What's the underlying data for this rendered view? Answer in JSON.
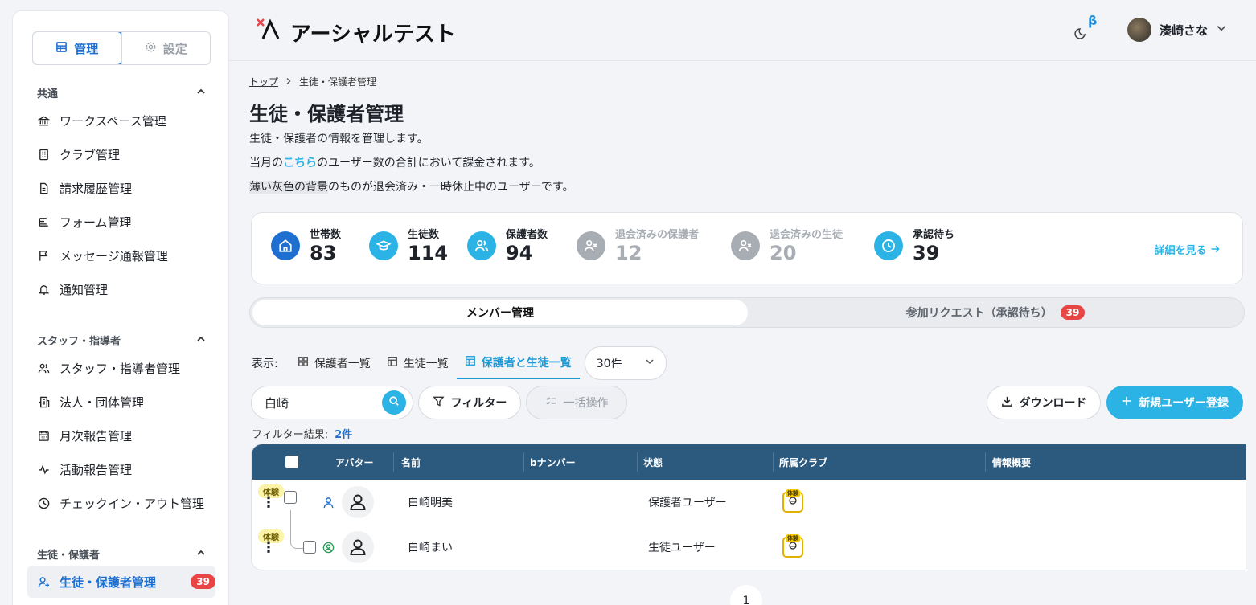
{
  "sidebar": {
    "mode_tabs": [
      {
        "label": "管理",
        "icon": "grid-icon"
      },
      {
        "label": "設定",
        "icon": "gear-icon"
      }
    ],
    "sections": [
      {
        "title": "共通",
        "items": [
          {
            "label": "ワークスペース管理",
            "icon": "bank-icon"
          },
          {
            "label": "クラブ管理",
            "icon": "building-icon"
          },
          {
            "label": "請求履歴管理",
            "icon": "invoice-icon"
          },
          {
            "label": "フォーム管理",
            "icon": "form-icon"
          },
          {
            "label": "メッセージ通報管理",
            "icon": "flag-icon"
          },
          {
            "label": "通知管理",
            "icon": "bell-icon"
          }
        ]
      },
      {
        "title": "スタッフ・指導者",
        "items": [
          {
            "label": "スタッフ・指導者管理",
            "icon": "users-icon"
          },
          {
            "label": "法人・団体管理",
            "icon": "office-icon"
          },
          {
            "label": "月次報告管理",
            "icon": "calendar-icon"
          },
          {
            "label": "活動報告管理",
            "icon": "activity-icon"
          },
          {
            "label": "チェックイン・アウト管理",
            "icon": "clock-icon"
          }
        ]
      },
      {
        "title": "生徒・保護者",
        "items": [
          {
            "label": "生徒・保護者管理",
            "icon": "user-plus-icon",
            "badge": "39",
            "active": true
          }
        ]
      }
    ]
  },
  "header": {
    "brand": "アーシャルテスト",
    "beta_mark": "β",
    "user_name": "湊崎さな"
  },
  "breadcrumb": {
    "home": "トップ",
    "current": "生徒・保護者管理"
  },
  "page": {
    "title": "生徒・保護者管理",
    "desc1": "生徒・保護者の情報を管理します。",
    "desc2_pre": "当月の",
    "desc2_link": "こちら",
    "desc2_post": "のユーザー数の合計において課金されます。",
    "desc3_hl": "薄い灰色の背景",
    "desc3_post": "のものが退会済み・一時休止中のユーザーです。"
  },
  "stats": {
    "items": [
      {
        "label": "世帯数",
        "value": "83",
        "icon": "home-icon",
        "color": "#1e6fd0"
      },
      {
        "label": "生徒数",
        "value": "114",
        "icon": "graduation-cap-icon",
        "color": "#2bb3e6"
      },
      {
        "label": "保護者数",
        "value": "94",
        "icon": "users-icon",
        "color": "#2bb3e6"
      },
      {
        "label": "退会済みの保護者",
        "value": "12",
        "icon": "user-x-icon",
        "color": "#a8adb4"
      },
      {
        "label": "退会済みの生徒",
        "value": "20",
        "icon": "user-x-icon",
        "color": "#a8adb4"
      },
      {
        "label": "承認待ち",
        "value": "39",
        "icon": "clock-icon",
        "color": "#2bb3e6"
      }
    ],
    "more_label": "詳細を見る"
  },
  "tabs": {
    "member": "メンバー管理",
    "requests": "参加リクエスト（承認待ち）",
    "requests_badge": "39"
  },
  "view": {
    "label": "表示:",
    "options": [
      "保護者一覧",
      "生徒一覧",
      "保護者と生徒一覧"
    ],
    "page_size": "30件"
  },
  "toolbar": {
    "search_value": "白崎",
    "filter": "フィルター",
    "bulk": "一括操作",
    "download": "ダウンロード",
    "new_user": "新規ユーザー登録"
  },
  "filter_result": {
    "label": "フィルター結果:",
    "count": "2件"
  },
  "table": {
    "headers": [
      "アバター",
      "名前",
      "bナンバー",
      "状態",
      "所属クラブ",
      "情報概要"
    ],
    "rows": [
      {
        "tag": "体験",
        "name": "白崎明美",
        "bnumber": "",
        "status": "保護者ユーザー",
        "club_tag": "体験"
      },
      {
        "tag": "体験",
        "name": "白崎まい",
        "bnumber": "",
        "status": "生徒ユーザー",
        "club_tag": "体験"
      }
    ]
  },
  "pager": {
    "page": "1"
  },
  "colors": {
    "brand": "#1e6fd0",
    "accent": "#2bb3e6",
    "header_row": "#2c5a7e",
    "badge": "#e84545"
  }
}
